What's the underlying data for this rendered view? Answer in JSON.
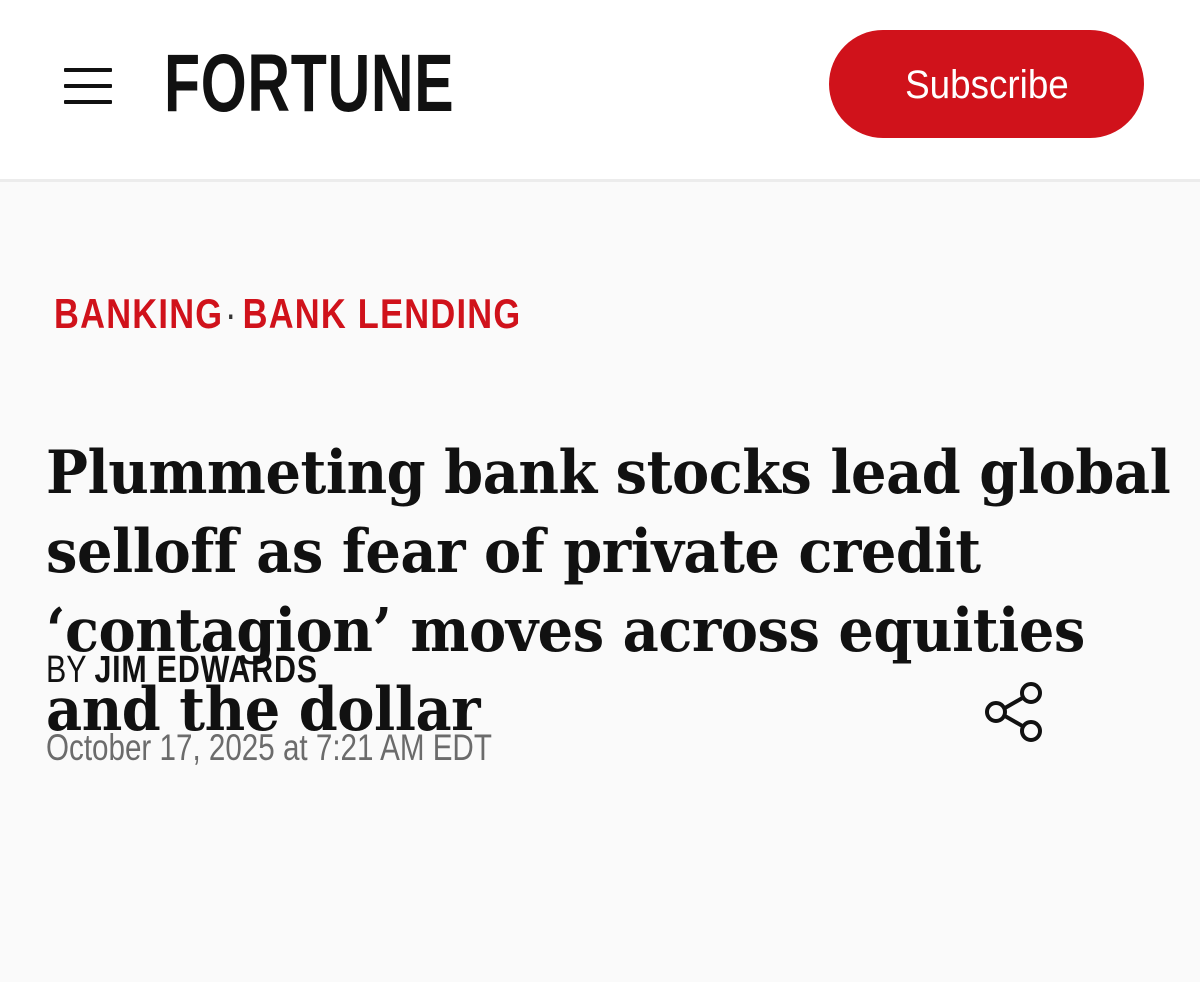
{
  "header": {
    "logo_text": "FORTUNE",
    "subscribe_label": "Subscribe",
    "menu_icon": "hamburger-menu-icon",
    "accent_color": "#d0121b"
  },
  "article": {
    "breadcrumb": {
      "primary": "BANKING",
      "separator": "·",
      "secondary": "BANK LENDING"
    },
    "headline_lines": [
      "Plummeting bank stocks lead global",
      "selloff as fear of private credit",
      "‘contagion’ moves across equities",
      "and the dollar"
    ],
    "byline": {
      "prefix": "BY",
      "author": "JIM EDWARDS"
    },
    "published": "October 17, 2025 at 7:21 AM EDT",
    "share_icon": "share-icon"
  }
}
